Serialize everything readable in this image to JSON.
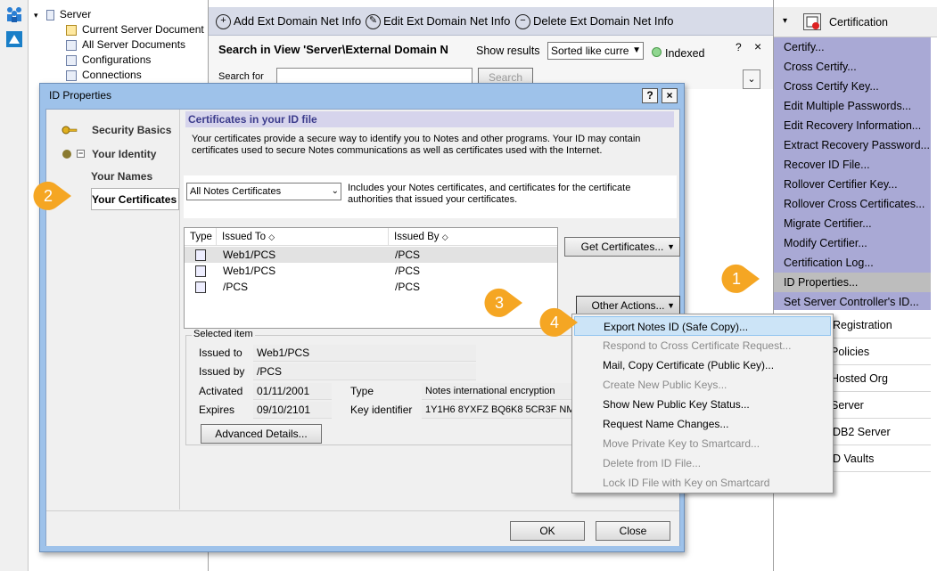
{
  "navigator": {
    "root": "Server",
    "items": [
      "Current Server Document",
      "All Server Documents",
      "Configurations",
      "Connections"
    ]
  },
  "actionbar": {
    "add": "Add Ext Domain Net Info",
    "edit": "Edit Ext Domain Net Info",
    "delete": "Delete Ext Domain Net Info"
  },
  "search": {
    "title": "Search in View 'Server\\External Domain N",
    "show_results_label": "Show results",
    "sort_value": "Sorted like curre",
    "indexed": "Indexed",
    "help": "?",
    "close": "×",
    "search_for": "Search for",
    "search_button": "Search"
  },
  "rightpanel": {
    "header": "Certification",
    "items": [
      "Certify...",
      "Cross Certify...",
      "Cross Certify Key...",
      "Edit Multiple Passwords...",
      "Edit Recovery Information...",
      "Extract Recovery Password...",
      "Recover ID File...",
      "Rollover Certifier Key...",
      "Rollover Cross Certificates...",
      "Migrate Certifier...",
      "Modify Certifier...",
      "Certification Log...",
      "ID Properties...",
      "Set Server Controller's ID..."
    ],
    "sections": [
      "Registration",
      "Policies",
      "Hosted Org",
      "Server",
      "DB2 Server",
      "D Vaults"
    ]
  },
  "dialog": {
    "title": "ID Properties",
    "help_btn": "?",
    "close_btn": "×",
    "nav": {
      "security_basics": "Security Basics",
      "your_identity": "Your Identity",
      "your_names": "Your Names",
      "your_certificates": "Your Certificates"
    },
    "section_title": "Certificates in your ID file",
    "intro": "Your certificates provide a secure way to identify you to Notes and other programs. Your ID may contain certificates used to secure Notes communications as well as certificates used with the Internet.",
    "filter_value": "All Notes Certificates",
    "filter_desc": "Includes your Notes certificates, and certificates for the certificate authorities that issued your certificates.",
    "table": {
      "headers": [
        "Type",
        "Issued To",
        "Issued By"
      ],
      "rows": [
        {
          "issued_to": "Web1/PCS",
          "issued_by": "/PCS"
        },
        {
          "issued_to": "Web1/PCS",
          "issued_by": "/PCS"
        },
        {
          "issued_to": "/PCS",
          "issued_by": "/PCS"
        }
      ]
    },
    "get_certificates": "Get Certificates...",
    "other_actions": "Other Actions...",
    "selected": {
      "group_label": "Selected item",
      "issued_to_label": "Issued to",
      "issued_to": "Web1/PCS",
      "issued_by_label": "Issued by",
      "issued_by": "/PCS",
      "activated_label": "Activated",
      "activated": "01/11/2001",
      "expires_label": "Expires",
      "expires": "09/10/2101",
      "type_label": "Type",
      "type": "Notes international encryption",
      "key_label": "Key identifier",
      "key": "1Y1H6 8YXFZ BQ6K8 5CR3F NMF"
    },
    "advanced": "Advanced Details...",
    "ok": "OK",
    "close": "Close"
  },
  "context_menu": [
    {
      "label": "Export Notes ID (Safe Copy)...",
      "state": "highlighted"
    },
    {
      "label": "Respond to Cross Certificate Request...",
      "state": "disabled"
    },
    {
      "label": "Mail, Copy Certificate (Public Key)...",
      "state": "enabled"
    },
    {
      "label": "Create New Public Keys...",
      "state": "disabled"
    },
    {
      "label": "Show New Public Key Status...",
      "state": "enabled"
    },
    {
      "label": "Request Name Changes...",
      "state": "enabled"
    },
    {
      "label": "Move Private Key to Smartcard...",
      "state": "disabled"
    },
    {
      "label": "Delete from ID File...",
      "state": "disabled"
    },
    {
      "label": "Lock ID File with Key on Smartcard",
      "state": "disabled"
    }
  ],
  "callouts": [
    "1",
    "2",
    "3",
    "4"
  ],
  "colors": {
    "callout": "#f5a623",
    "cert_panel": "#a9a9d5",
    "dialog_frame": "#9ec2ea",
    "menu_highlight": "#cce4f7"
  }
}
